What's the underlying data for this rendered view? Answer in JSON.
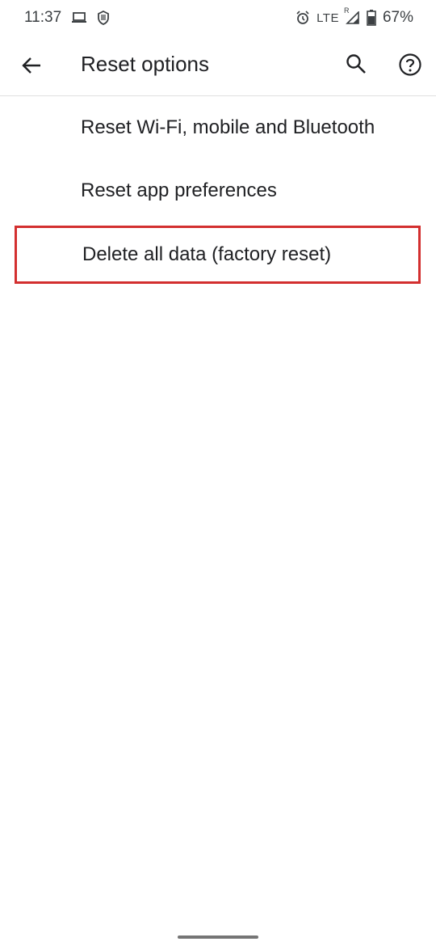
{
  "status_bar": {
    "time": "11:37",
    "network": "LTE",
    "roaming": "R",
    "battery": "67%",
    "left_icons": [
      "laptop-icon",
      "shield-icon"
    ],
    "right_icons": [
      "alarm-icon",
      "signal-icon",
      "battery-icon"
    ]
  },
  "app_bar": {
    "title": "Reset options",
    "icons": [
      "back-arrow-icon",
      "search-icon",
      "help-icon"
    ]
  },
  "options": [
    {
      "label": "Reset Wi-Fi, mobile and Bluetooth"
    },
    {
      "label": "Reset app preferences"
    },
    {
      "label": "Delete all data (factory reset)",
      "highlighted": true
    }
  ],
  "colors": {
    "highlight_border": "#d32f2f",
    "text": "#202124",
    "background": "#ffffff"
  }
}
